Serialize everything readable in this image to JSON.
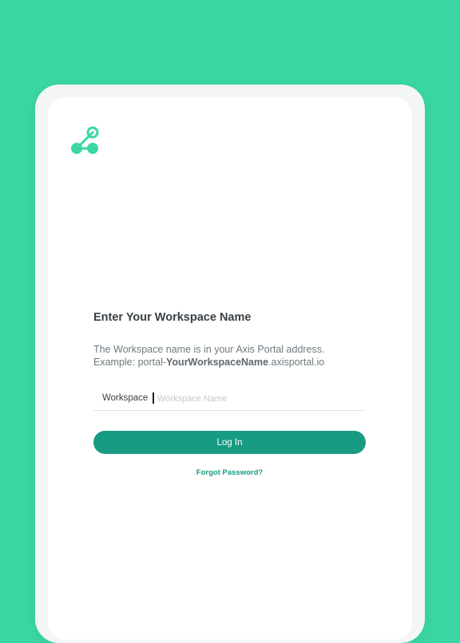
{
  "brand": {
    "logo_icon": "axis-nodes-icon",
    "accent_color": "#3ad7a4",
    "button_color": "#179b82"
  },
  "login": {
    "title": "Enter Your Workspace Name",
    "description_line1": "The Workspace name is in your Axis Portal address.",
    "description_prefix": "Example: portal-",
    "description_bold": "YourWorkspaceName",
    "description_suffix": ".axisportal.io",
    "field_label": "Workspace",
    "field_placeholder": "Workspace Name",
    "field_value": "",
    "button_label": "Log In",
    "forgot_link": "Forgot Password?"
  }
}
